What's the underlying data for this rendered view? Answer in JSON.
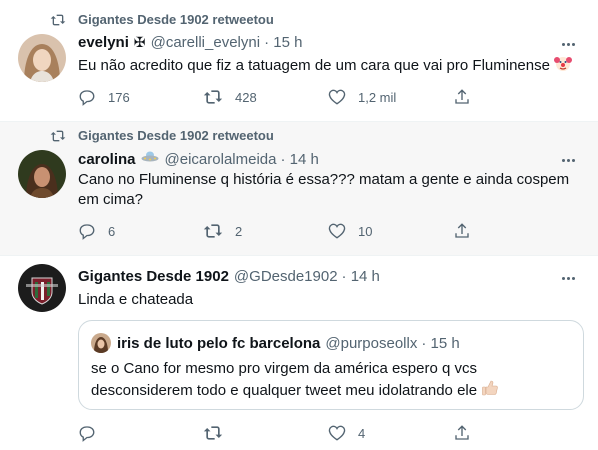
{
  "colors": {
    "text": "#0f1419",
    "secondary": "#536471",
    "border": "#eff3f4",
    "quote_border": "#cfd9de",
    "highlight_bg": "#f7f7f7"
  },
  "tweets": [
    {
      "retweet_label": "Gigantes Desde 1902 retweetou",
      "name": "evelyni",
      "name_badge": "✠",
      "handle": "@carelli_evelyni",
      "time": "· 15 h",
      "text": "Eu não acredito que fiz a tatuagem de um cara que vai pro Fluminense",
      "text_emoji": "clown-face-emoji",
      "replies": "176",
      "retweets": "428",
      "likes": "1,2 mil"
    },
    {
      "retweet_label": "Gigantes Desde 1902 retweetou",
      "name": "carolina",
      "name_emoji": "flying-saucer-emoji",
      "handle": "@eicarolalmeida",
      "time": "· 14 h",
      "text_line1": "Cano no Fluminense q história é essa??? matam a gente e ainda cospem",
      "text_line2": "em cima?",
      "replies": "6",
      "retweets": "2",
      "likes": "10"
    },
    {
      "name": "Gigantes Desde 1902",
      "handle": "@GDesde1902",
      "time": "· 14 h",
      "text": "Linda e chateada",
      "quote": {
        "name": "iris de luto pelo fc barcelona",
        "handle": "@purposeollx",
        "time": "· 15 h",
        "text_line1": "se o Cano for mesmo pro virgem da américa espero q vcs",
        "text_line2": "desconsiderem todo e qualquer tweet meu idolatrando ele",
        "text_emoji": "thumbs-up-emoji"
      },
      "replies": "",
      "retweets": "",
      "likes": "4"
    }
  ]
}
